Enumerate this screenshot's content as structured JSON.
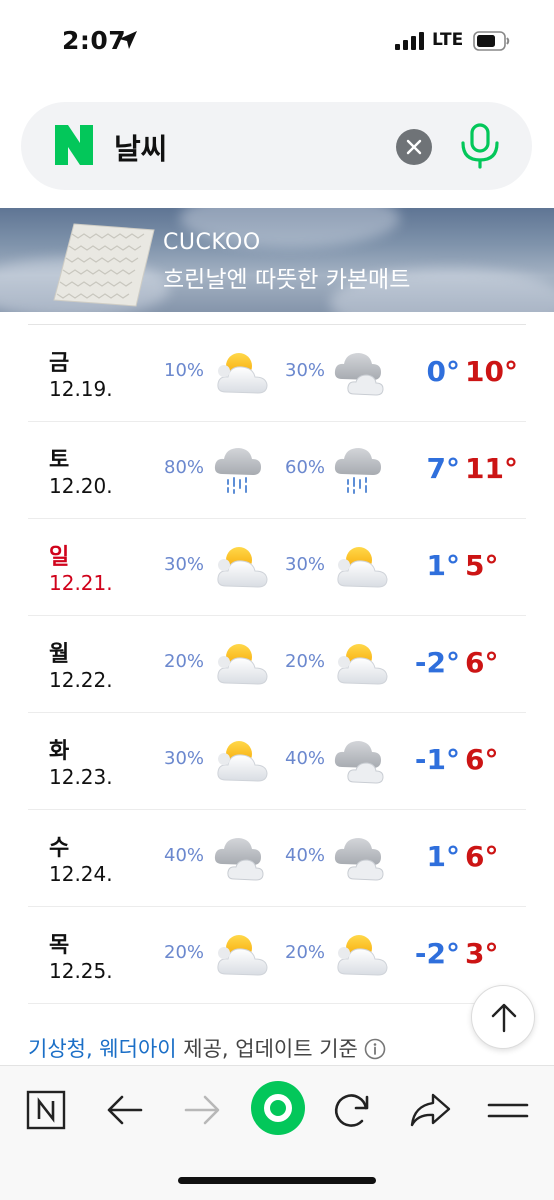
{
  "status_bar": {
    "time": "2:07",
    "network": "LTE"
  },
  "search": {
    "query": "날씨"
  },
  "ad": {
    "brand": "CUCKOO",
    "tagline": "흐린날엔 따뜻한 카본매트"
  },
  "forecast": [
    {
      "day": "금",
      "date": "12.19.",
      "am_pct": "10%",
      "am_icon": "partly-cloudy-icon",
      "pm_pct": "30%",
      "pm_icon": "cloudy-icon",
      "low": "0°",
      "high": "10°"
    },
    {
      "day": "토",
      "date": "12.20.",
      "am_pct": "80%",
      "am_icon": "rain-icon",
      "pm_pct": "60%",
      "pm_icon": "rain-icon",
      "low": "7°",
      "high": "11°"
    },
    {
      "day": "일",
      "date": "12.21.",
      "am_pct": "30%",
      "am_icon": "partly-cloudy-icon",
      "pm_pct": "30%",
      "pm_icon": "partly-cloudy-icon",
      "low": "1°",
      "high": "5°"
    },
    {
      "day": "월",
      "date": "12.22.",
      "am_pct": "20%",
      "am_icon": "partly-cloudy-icon",
      "pm_pct": "20%",
      "pm_icon": "partly-cloudy-icon",
      "low": "-2°",
      "high": "6°"
    },
    {
      "day": "화",
      "date": "12.23.",
      "am_pct": "30%",
      "am_icon": "partly-cloudy-icon",
      "pm_pct": "40%",
      "pm_icon": "cloudy-icon",
      "low": "-1°",
      "high": "6°"
    },
    {
      "day": "수",
      "date": "12.24.",
      "am_pct": "40%",
      "am_icon": "cloudy-icon",
      "pm_pct": "40%",
      "pm_icon": "cloudy-icon",
      "low": "1°",
      "high": "6°"
    },
    {
      "day": "목",
      "date": "12.25.",
      "am_pct": "20%",
      "am_icon": "partly-cloudy-icon",
      "pm_pct": "20%",
      "pm_icon": "partly-cloudy-icon",
      "low": "-2°",
      "high": "3°"
    }
  ],
  "source": {
    "provider": "기상청, 웨더아이",
    "suffix": " 제공, 업데이트 기준"
  },
  "colors": {
    "low_temp": "#2f6fdc",
    "high_temp": "#cc1414",
    "sunday": "#d0021b",
    "naver_green": "#03c75a",
    "provider_link": "#1b6fc7"
  }
}
